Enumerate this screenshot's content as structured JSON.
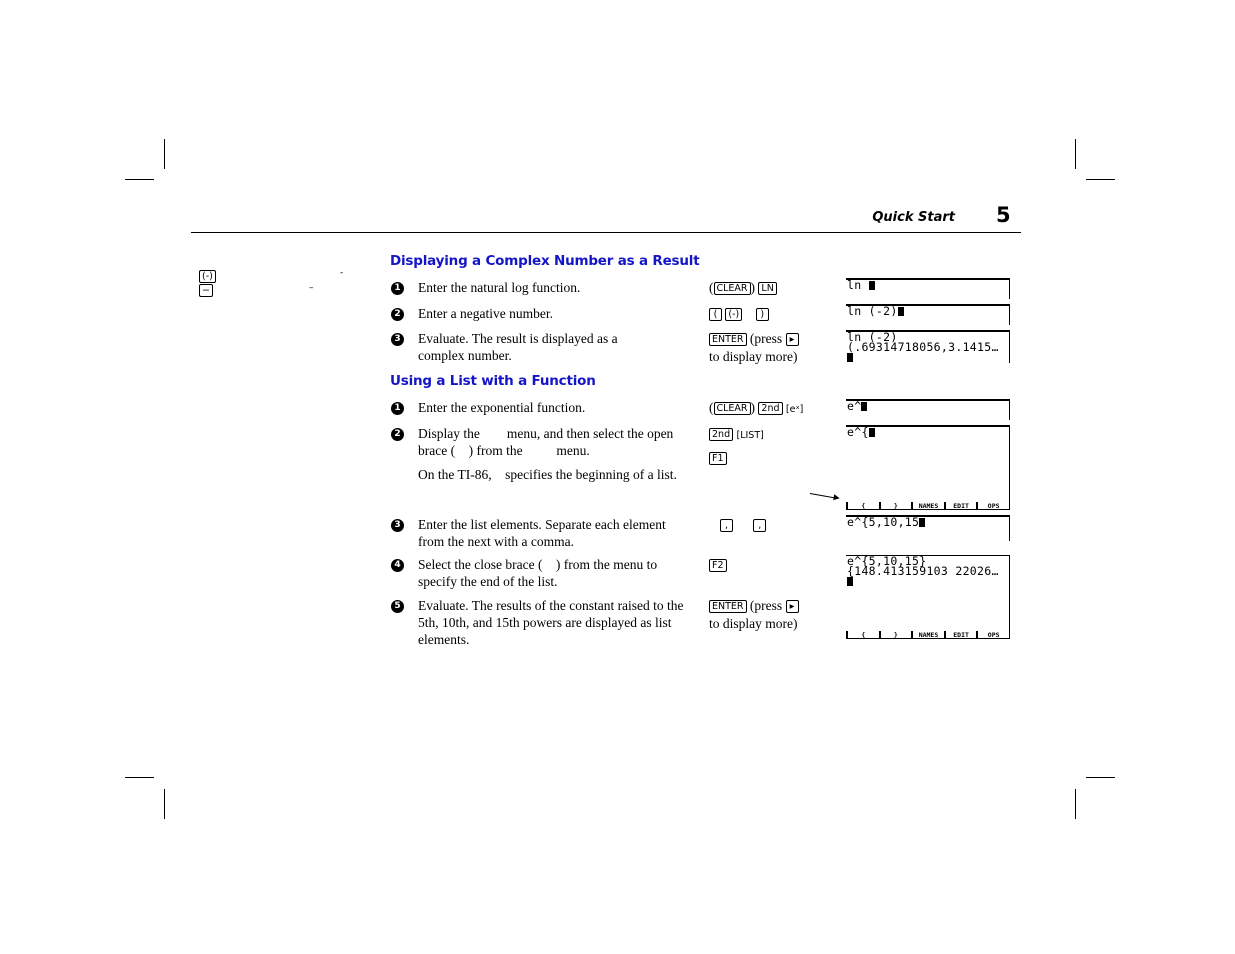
{
  "header": {
    "running_head": "Quick Start",
    "page_number": "5"
  },
  "margin_note": {
    "keys": [
      "(-)",
      "−"
    ],
    "dashes": [
      "-",
      "–"
    ]
  },
  "sections": [
    {
      "title": "Displaying a Complex Number as a Result",
      "steps": [
        {
          "num": "1",
          "text": "Enter the natural log function.",
          "keys_before": "(",
          "keys": [
            "CLEAR"
          ],
          "keys_after": ")",
          "keys2": [
            "LN"
          ],
          "screen": [
            "ln "
          ]
        },
        {
          "num": "2",
          "text": "Enter a negative number.",
          "keys": [
            "(",
            "(-)",
            ")"
          ],
          "screen": [
            "ln (-2)"
          ]
        },
        {
          "num": "3",
          "text": "Evaluate. The result is displayed as a complex number.",
          "keys": [
            "ENTER"
          ],
          "keys_text": "(press",
          "keys_arrow": "▸",
          "keys_text2": "to display more)",
          "screen": [
            "ln (-2)",
            "(.69314718056,3.1415…",
            ""
          ]
        }
      ]
    },
    {
      "title": "Using a List with a Function",
      "steps": [
        {
          "num": "1",
          "text": "Enter the exponential function.",
          "keys_before": "(",
          "keys": [
            "CLEAR"
          ],
          "keys_after": ")",
          "keys2": [
            "2nd"
          ],
          "keys3": "[eˣ]",
          "screen": [
            "e^"
          ]
        },
        {
          "num": "2",
          "text": "Display the        menu, and then select the open brace (    ) from the          menu.",
          "note": "On the TI-86,    specifies the beginning of a list.",
          "keys": [
            "2nd"
          ],
          "keys_list": "[LIST]",
          "keys_f": [
            "F1"
          ],
          "screen": [
            "e^{"
          ],
          "menu": [
            "{",
            "}",
            "NAMES",
            "EDIT",
            "OPS"
          ]
        },
        {
          "num": "3",
          "text": "Enter the list elements. Separate each element from the next with a comma.",
          "keys": [
            ",",
            ","
          ],
          "screen": [
            "e^{5,10,15"
          ]
        },
        {
          "num": "4",
          "text": "Select the close brace (    ) from the menu to specify the end of the list.",
          "keys": [
            "F2"
          ]
        },
        {
          "num": "5",
          "text": "Evaluate. The results of the constant raised to the 5th, 10th, and 15th powers are displayed as list elements.",
          "keys": [
            "ENTER"
          ],
          "keys_text": "(press",
          "keys_arrow": "▸",
          "keys_text2": "to display more)",
          "screen": [
            "e^{5,10,15}",
            "{148.413159103 22026…",
            ""
          ],
          "menu": [
            "{",
            "}",
            "NAMES",
            "EDIT",
            "OPS"
          ]
        }
      ]
    }
  ]
}
